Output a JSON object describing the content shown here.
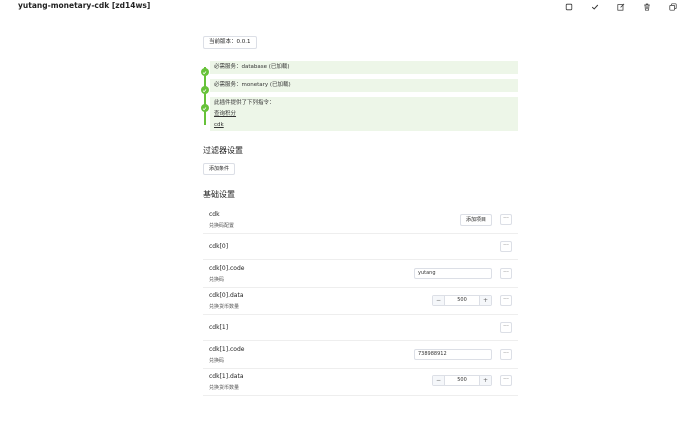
{
  "header": {
    "title": "yutang-monetary-cdk [zd14ws]",
    "icons": [
      "square-icon",
      "check-icon",
      "edit-icon",
      "trash-icon",
      "copy-icon"
    ]
  },
  "version": {
    "label": "当前版本：0.0.1"
  },
  "timeline": {
    "items": [
      {
        "text": "必需服务：database (已加载)"
      },
      {
        "text": "必需服务：monetary (已加载)"
      },
      {
        "text": "此插件提供了下列指令：",
        "links": [
          "查询积分",
          "cdk"
        ]
      }
    ]
  },
  "filter": {
    "title": "过滤器设置",
    "add_button": "添加条件"
  },
  "basic": {
    "title": "基础设置",
    "rows": [
      {
        "label": "cdk",
        "desc": "兑换码配置",
        "button": "添加项目"
      },
      {
        "label": "cdk[0]"
      },
      {
        "label": "cdk[0].code",
        "desc": "兑换码",
        "value": "yutang"
      },
      {
        "label": "cdk[0].data",
        "desc": "兑换货币数量",
        "value": "500"
      },
      {
        "label": "cdk[1]"
      },
      {
        "label": "cdk[1].code",
        "desc": "兑换码",
        "value": "738988912"
      },
      {
        "label": "cdk[1].data",
        "desc": "兑换货币数量",
        "value": "500"
      }
    ],
    "more_label": "···",
    "minus_label": "−",
    "plus_label": "+"
  }
}
